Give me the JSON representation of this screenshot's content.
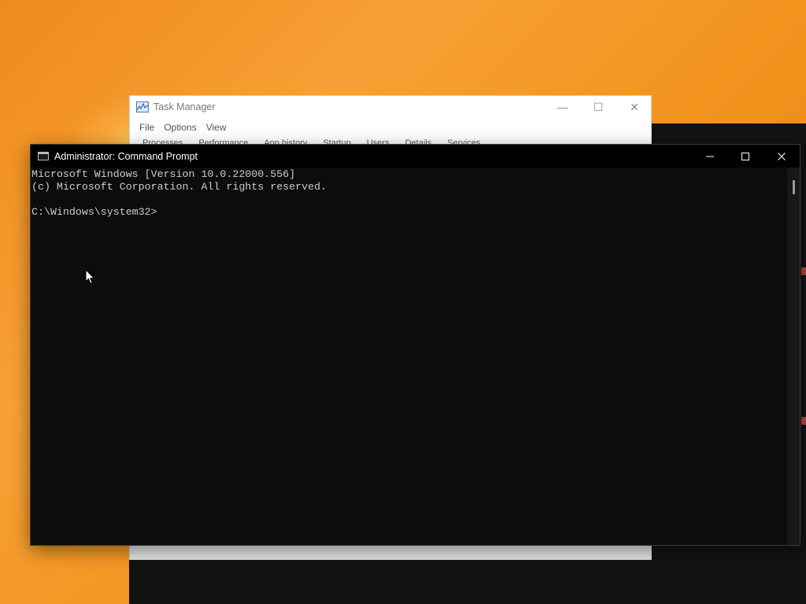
{
  "task_manager": {
    "title": "Task Manager",
    "menu": [
      "File",
      "Options",
      "View"
    ],
    "tabs": [
      "Processes",
      "Performance",
      "App history",
      "Startup",
      "Users",
      "Details",
      "Services"
    ],
    "controls": {
      "minimize": "—",
      "maximize": "☐",
      "close": "✕"
    }
  },
  "cmd": {
    "title": "Administrator: Command Prompt",
    "lines": [
      "Microsoft Windows [Version 10.0.22000.556]",
      "(c) Microsoft Corporation. All rights reserved.",
      "",
      "C:\\Windows\\system32>"
    ],
    "controls": {
      "minimize": "—",
      "maximize": "☐",
      "close": "✕"
    }
  },
  "colors": {
    "desktop_accent": "#f2941f",
    "console_bg": "#0c0c0c",
    "console_text": "#cccccc"
  }
}
